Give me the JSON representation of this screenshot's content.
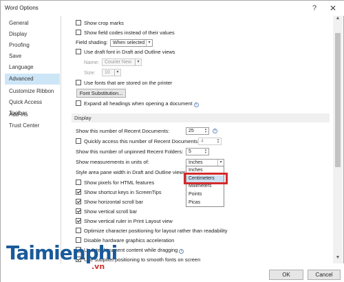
{
  "window": {
    "title": "Word Options",
    "help": "?",
    "close": "✕"
  },
  "sidebar": {
    "items": [
      {
        "label": "General"
      },
      {
        "label": "Display"
      },
      {
        "label": "Proofing"
      },
      {
        "label": "Save"
      },
      {
        "label": "Language"
      },
      {
        "label": "Advanced",
        "active": true
      },
      {
        "label": "Customize Ribbon"
      },
      {
        "label": "Quick Access Toolbar"
      },
      {
        "label": "Add-Ins"
      },
      {
        "label": "Trust Center"
      }
    ]
  },
  "content": {
    "show_crop_marks": "Show crop marks",
    "show_field_codes": "Show field codes instead of their values",
    "field_shading_label": "Field shading:",
    "field_shading_value": "When selected",
    "use_draft_font": "Use draft font in Draft and Outline views",
    "name_label": "Name:",
    "name_value": "Courier New",
    "size_label": "Size:",
    "size_value": "10",
    "use_printer_fonts": "Use fonts that are stored on the printer",
    "font_substitution_button": "Font Substitution...",
    "expand_headings": "Expand all headings when opening a document",
    "display_section": "Display",
    "recent_docs_label": "Show this number of Recent Documents:",
    "recent_docs_value": "25",
    "quick_access_label": "Quickly access this number of Recent Documents:",
    "quick_access_value": "4",
    "recent_folders_label": "Show this number of unpinned Recent Folders:",
    "recent_folders_value": "5",
    "measurements_label": "Show measurements in units of:",
    "measurements_value": "Inches",
    "style_area_label": "Style area pane width in Draft and Outline views:",
    "show_pixels": "Show pixels for HTML features",
    "show_shortcut_keys": "Show shortcut keys in ScreenTips",
    "show_horizontal_scroll": "Show horizontal scroll bar",
    "show_vertical_scroll": "Show vertical scroll bar",
    "show_vertical_ruler": "Show vertical ruler in Print Layout view",
    "optimize_char_positioning": "Optimize character positioning for layout rather than readability",
    "disable_hw_accel": "Disable hardware graphics acceleration",
    "update_while_dragging": "Update document content while dragging",
    "subpixel_positioning": "Use subpixel positioning to smooth fonts on screen"
  },
  "dropdown_options": [
    "Inches",
    "Centimeters",
    "Millimeters",
    "Points",
    "Picas"
  ],
  "footer": {
    "ok": "OK",
    "cancel": "Cancel"
  },
  "watermark": {
    "text": "Taimienphi",
    "sub": ".vn"
  },
  "colors": {
    "accent": "#cde6f7",
    "highlight": "#d42a2a",
    "watermark": "#1a5a9a"
  }
}
